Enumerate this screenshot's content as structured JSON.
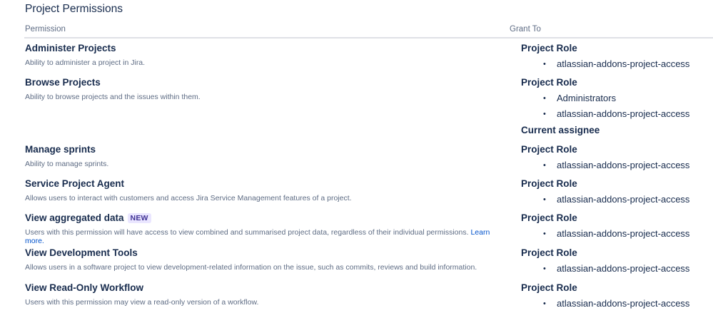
{
  "page": {
    "title": "Project Permissions",
    "header": {
      "permission": "Permission",
      "grant_to": "Grant To"
    }
  },
  "permissions": [
    {
      "name": "Administer Projects",
      "description": "Ability to administer a project in Jira.",
      "grants": [
        {
          "type": "Project Role",
          "members": [
            "atlassian-addons-project-access"
          ]
        }
      ]
    },
    {
      "name": "Browse Projects",
      "description": "Ability to browse projects and the issues within them.",
      "grants": [
        {
          "type": "Project Role",
          "members": [
            "Administrators",
            "atlassian-addons-project-access"
          ]
        },
        {
          "type": "Current assignee",
          "members": []
        }
      ]
    },
    {
      "name": "Manage sprints",
      "description": "Ability to manage sprints.",
      "grants": [
        {
          "type": "Project Role",
          "members": [
            "atlassian-addons-project-access"
          ]
        }
      ]
    },
    {
      "name": "Service Project Agent",
      "description": "Allows users to interact with customers and access Jira Service Management features of a project.",
      "grants": [
        {
          "type": "Project Role",
          "members": [
            "atlassian-addons-project-access"
          ]
        }
      ]
    },
    {
      "name": "View aggregated data",
      "badge": "NEW",
      "description": "Users with this permission will have access to view combined and summarised project data, regardless of their individual permissions.",
      "link": "Learn more.",
      "grants": [
        {
          "type": "Project Role",
          "members": [
            "atlassian-addons-project-access"
          ]
        }
      ]
    },
    {
      "name": "View Development Tools",
      "description": "Allows users in a software project to view development-related information on the issue, such as commits, reviews and build information.",
      "grants": [
        {
          "type": "Project Role",
          "members": [
            "atlassian-addons-project-access"
          ]
        }
      ]
    },
    {
      "name": "View Read-Only Workflow",
      "description": "Users with this permission may view a read-only version of a workflow.",
      "grants": [
        {
          "type": "Project Role",
          "members": [
            "atlassian-addons-project-access"
          ]
        }
      ]
    }
  ],
  "colors": {
    "text": "#172b4d",
    "subtle": "#5e6c84",
    "link": "#0052cc",
    "badge_bg": "#eae6ff",
    "badge_text": "#403294",
    "divider": "#dfe1e6"
  }
}
